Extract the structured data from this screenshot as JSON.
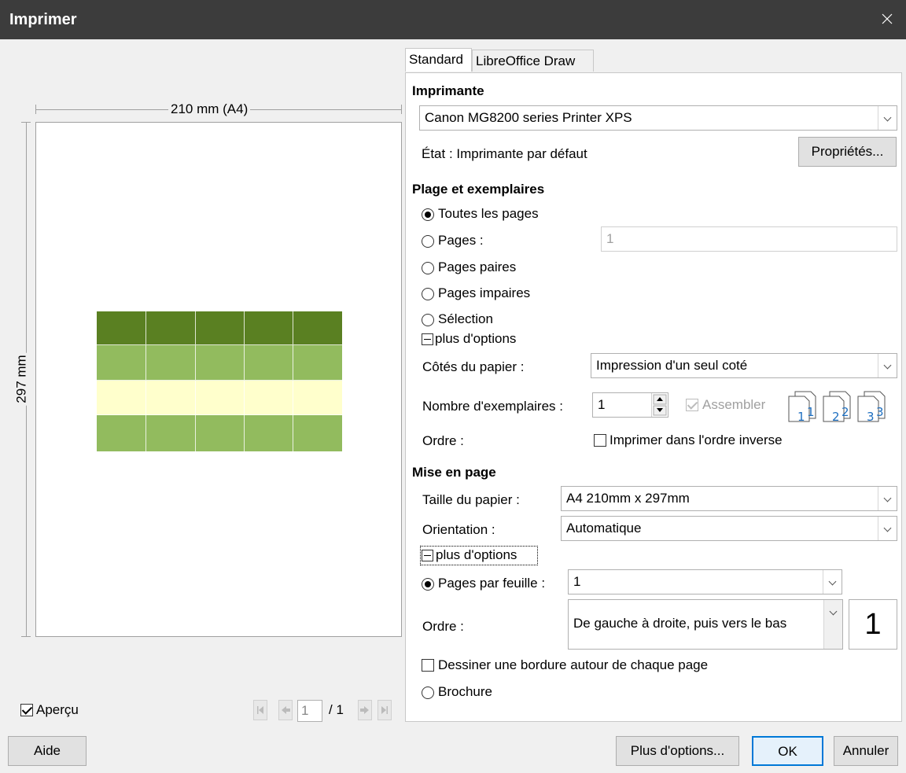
{
  "window": {
    "title": "Imprimer"
  },
  "preview": {
    "width_label": "210 mm (A4)",
    "height_label": "297 mm",
    "checkbox_label": "Aperçu",
    "page_current": "1",
    "page_total": "/ 1",
    "table_colors": {
      "dark": "#5a8022",
      "medium": "#92bb5e",
      "light": "#ffffcc"
    }
  },
  "tabs": {
    "standard": "Standard",
    "draw": "LibreOffice Draw"
  },
  "printer": {
    "section": "Imprimante",
    "selected": "Canon MG8200 series Printer XPS",
    "status": "État : Imprimante par défaut",
    "properties_button": "Propriétés..."
  },
  "range": {
    "section": "Plage et exemplaires",
    "all_pages": "Toutes les pages",
    "pages": "Pages :",
    "pages_value": "1",
    "even_pages": "Pages paires",
    "odd_pages": "Pages impaires",
    "selection": "Sélection",
    "more_options": "plus d'options",
    "paper_sides_label": "Côtés du papier :",
    "paper_sides_value": "Impression d'un seul coté",
    "copies_label": "Nombre d'exemplaires :",
    "copies_value": "1",
    "collate": "Assembler",
    "order_label": "Ordre :",
    "reverse_order": "Imprimer dans l'ordre inverse"
  },
  "layout": {
    "section": "Mise en page",
    "paper_size_label": "Taille du papier :",
    "paper_size_value": "A4 210mm x 297mm",
    "orientation_label": "Orientation :",
    "orientation_value": "Automatique",
    "more_options": "plus d'options",
    "pages_per_sheet_label": "Pages par feuille :",
    "pages_per_sheet_value": "1",
    "order_label": "Ordre :",
    "order_value": "De gauche à droite, puis vers le bas",
    "order_preview": "1",
    "draw_border": "Dessiner une bordure autour de chaque page",
    "brochure": "Brochure"
  },
  "buttons": {
    "help": "Aide",
    "more_options": "Plus d'options...",
    "ok": "OK",
    "cancel": "Annuler"
  },
  "collate_icons": [
    "1",
    "1",
    "2",
    "2",
    "3",
    "3"
  ]
}
